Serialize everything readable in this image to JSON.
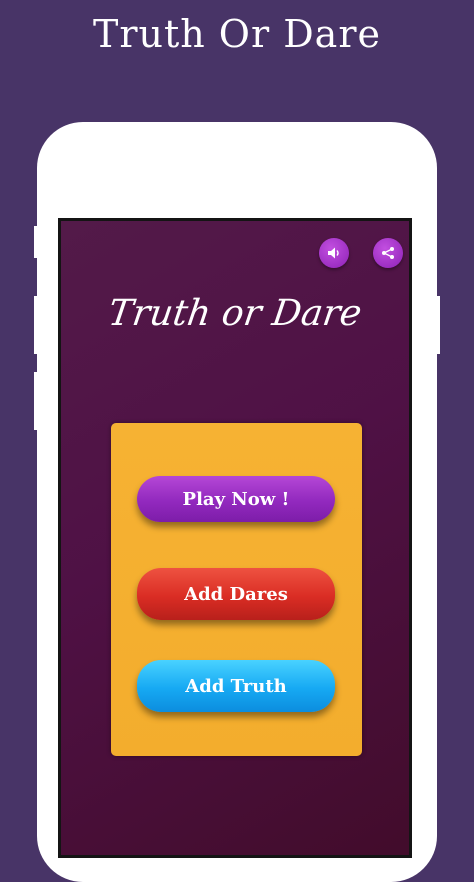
{
  "promo": {
    "title": "Truth Or Dare"
  },
  "app": {
    "title": "Truth or Dare",
    "toolbar": {
      "sound_icon": "speaker-icon",
      "share_icon": "share-icon"
    },
    "menu": {
      "play_label": "Play Now !",
      "add_dares_label": "Add Dares",
      "add_truth_label": "Add Truth"
    }
  },
  "colors": {
    "background": "#483467",
    "screen": "#4f1145",
    "panel": "#f4af2f",
    "play_button": "#9229be",
    "dares_button": "#da2d24",
    "truth_button": "#16a9f3",
    "icon_button": "#a83acb"
  }
}
